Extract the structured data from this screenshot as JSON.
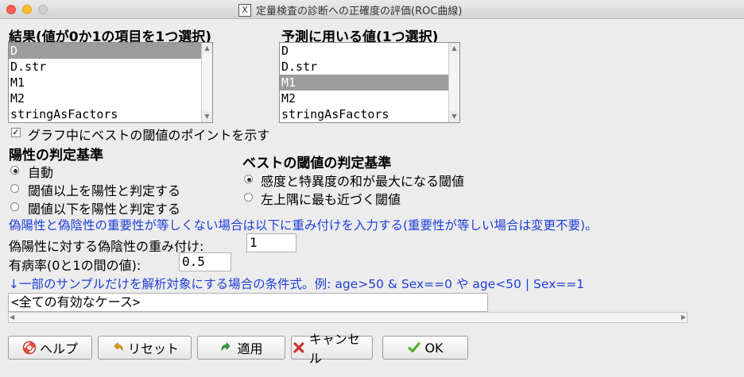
{
  "window": {
    "title": "定量検査の診断への正確度の評価(ROC曲線)",
    "title_icon": "X"
  },
  "outcome": {
    "label": "結果(値が0か1の項目を1つ選択)",
    "items": [
      "D",
      "D.str",
      "M1",
      "M2",
      "stringAsFactors"
    ],
    "selected": "D"
  },
  "predictor": {
    "label": "予測に用いる値(1つ選択)",
    "items": [
      "D",
      "D.str",
      "M1",
      "M2",
      "stringAsFactors"
    ],
    "selected": "M1"
  },
  "best_point": {
    "label": "グラフ中にベストの閾値のポイントを示す",
    "checked": true
  },
  "positive_criterion": {
    "label": "陽性の判定基準",
    "options": [
      "自動",
      "閾値以上を陽性と判定する",
      "閾値以下を陽性と判定する"
    ],
    "selected": "自動"
  },
  "best_criterion": {
    "label": "ベストの閾値の判定基準",
    "options": [
      "感度と特異度の和が最大になる閾値",
      "左上隅に最も近づく閾値"
    ],
    "selected": "感度と特異度の和が最大になる閾値"
  },
  "weight_note": "偽陽性と偽陰性の重要性が等しくない場合は以下に重み付けを入力する(重要性が等しい場合は変更不要)。",
  "weight": {
    "label": "偽陽性に対する偽陰性の重み付け:",
    "value": "1"
  },
  "prevalence": {
    "label": "有病率(0と1の間の値):",
    "value": "0.5"
  },
  "subset": {
    "note": "↓一部のサンプルだけを解析対象にする場合の条件式。例: age>50 & Sex==0 や age<50 | Sex==1",
    "value": "<全ての有効なケース>"
  },
  "buttons": {
    "help": "ヘルプ",
    "reset": "リセット",
    "apply": "適用",
    "cancel": "キャンセル",
    "ok": "OK"
  },
  "colors": {
    "note_text": "#1f3fd8",
    "selection": "#9c9c9c"
  }
}
